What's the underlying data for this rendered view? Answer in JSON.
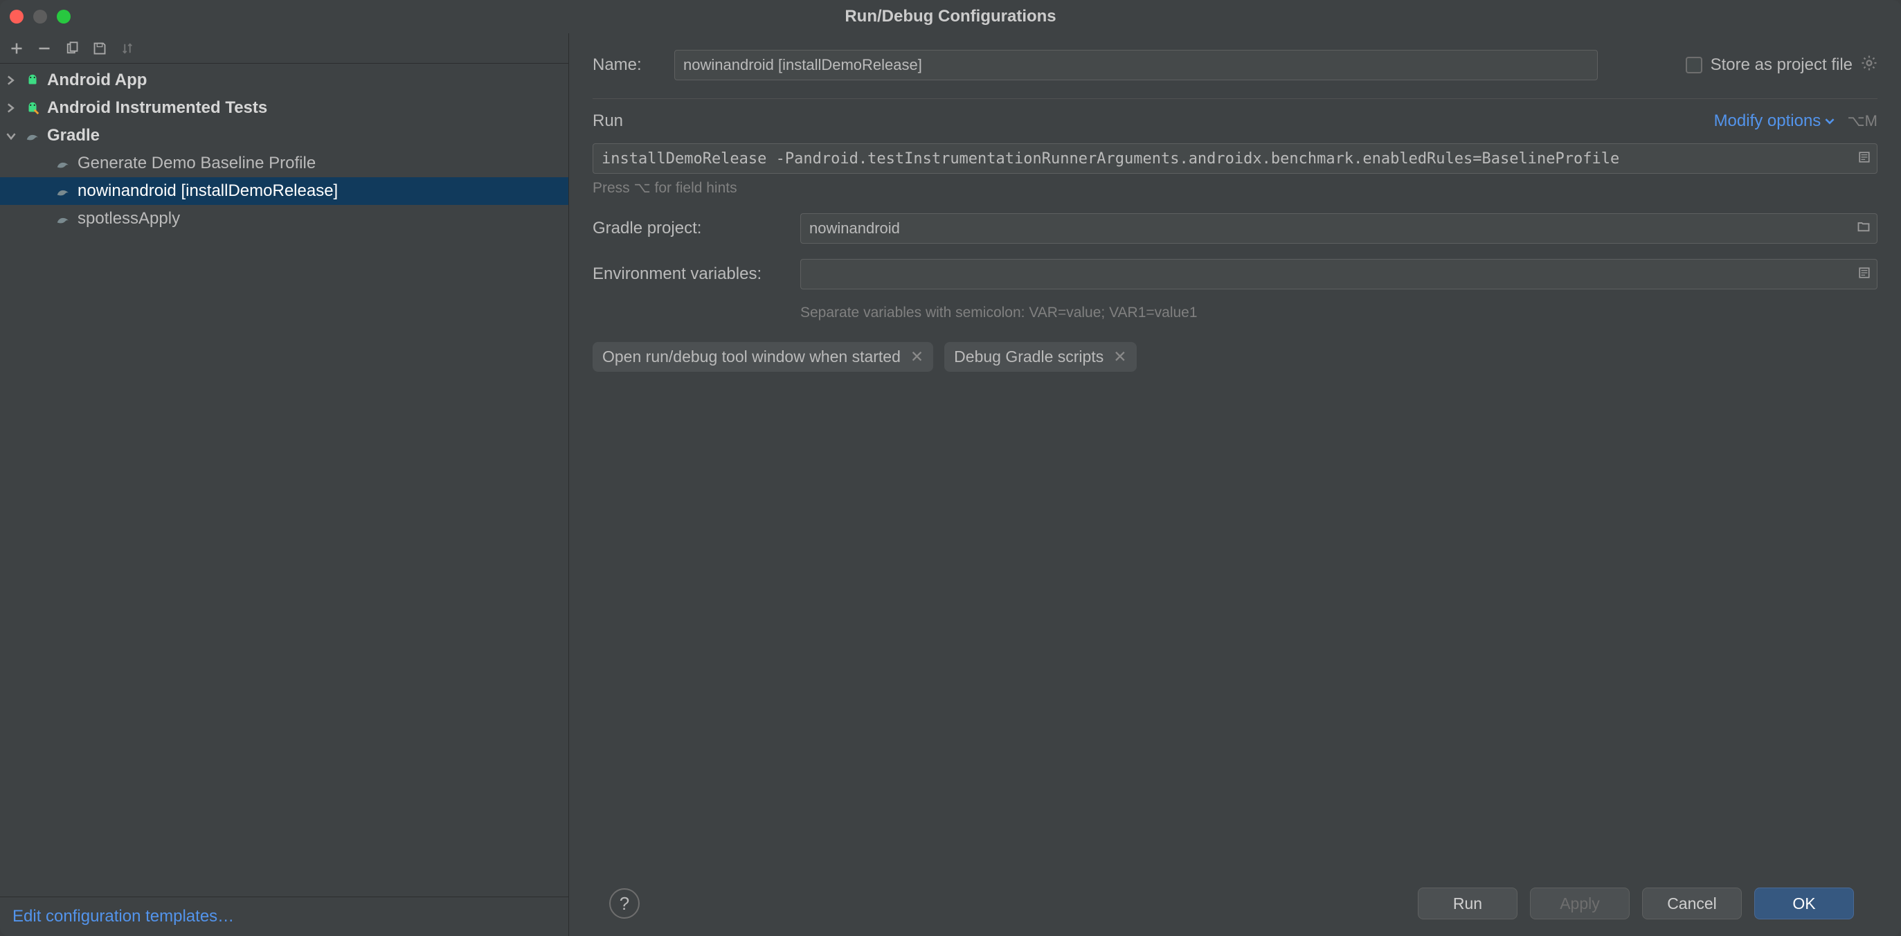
{
  "window": {
    "title": "Run/Debug Configurations"
  },
  "toolbar": {
    "add": "Add",
    "remove": "Remove",
    "copy": "Copy",
    "save": "Save",
    "updown": "Sort"
  },
  "tree": {
    "items": [
      {
        "label": "Android App",
        "expanded": false,
        "bold": true,
        "type": "android"
      },
      {
        "label": "Android Instrumented Tests",
        "expanded": false,
        "bold": true,
        "type": "android-test"
      },
      {
        "label": "Gradle",
        "expanded": true,
        "bold": true,
        "type": "gradle"
      }
    ],
    "gradle_children": [
      {
        "label": "Generate Demo Baseline Profile",
        "selected": false
      },
      {
        "label": "nowinandroid [installDemoRelease]",
        "selected": true
      },
      {
        "label": "spotlessApply",
        "selected": false
      }
    ]
  },
  "sidebar_footer": {
    "edit_templates": "Edit configuration templates…"
  },
  "form": {
    "name_label": "Name:",
    "name_value": "nowinandroid [installDemoRelease]",
    "store_label": "Store as project file",
    "run_section": "Run",
    "modify_options": "Modify options",
    "modify_shortcut": "⌥M",
    "command_value": "installDemoRelease -Pandroid.testInstrumentationRunnerArguments.androidx.benchmark.enabledRules=BaselineProfile",
    "command_hint": "Press ⌥ for field hints",
    "gradle_project_label": "Gradle project:",
    "gradle_project_value": "nowinandroid",
    "env_label": "Environment variables:",
    "env_value": "",
    "env_hint": "Separate variables with semicolon: VAR=value; VAR1=value1",
    "chip1": "Open run/debug tool window when started",
    "chip2": "Debug Gradle scripts"
  },
  "footer": {
    "help": "?",
    "run": "Run",
    "apply": "Apply",
    "cancel": "Cancel",
    "ok": "OK"
  }
}
